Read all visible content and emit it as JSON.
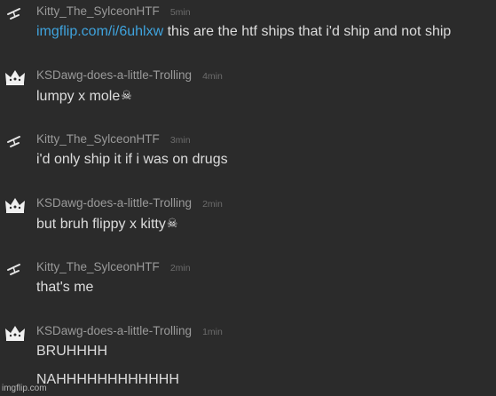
{
  "messages": [
    {
      "author": "Kitty_The_SylceonHTF",
      "time": "5min",
      "avatar_icon": "sword-icon",
      "link": "imgflip.com/i/6uhlxw",
      "text": " this are the htf ships that i'd ship and not ship"
    },
    {
      "author": "KSDawg-does-a-little-Trolling",
      "time": "4min",
      "avatar_icon": "crown-icon",
      "text": "lumpy x mole",
      "emoji": "☠"
    },
    {
      "author": "Kitty_The_SylceonHTF",
      "time": "3min",
      "avatar_icon": "sword-icon",
      "text": "i'd only ship it if i was on drugs"
    },
    {
      "author": "KSDawg-does-a-little-Trolling",
      "time": "2min",
      "avatar_icon": "crown-icon",
      "text": "but bruh flippy x kitty",
      "emoji": "☠"
    },
    {
      "author": "Kitty_The_SylceonHTF",
      "time": "2min",
      "avatar_icon": "sword-icon",
      "text": "that's me"
    },
    {
      "author": "KSDawg-does-a-little-Trolling",
      "time": "1min",
      "avatar_icon": "crown-icon",
      "text": "BRUHHHH",
      "text2": "NAHHHHHHHHHHHH"
    }
  ],
  "watermark": "imgflip.com",
  "colors": {
    "background": "#2b2b2b",
    "author": "#9a9a9a",
    "time": "#6c6c6c",
    "text": "#dcdcdc",
    "link": "#3fa3dd"
  }
}
